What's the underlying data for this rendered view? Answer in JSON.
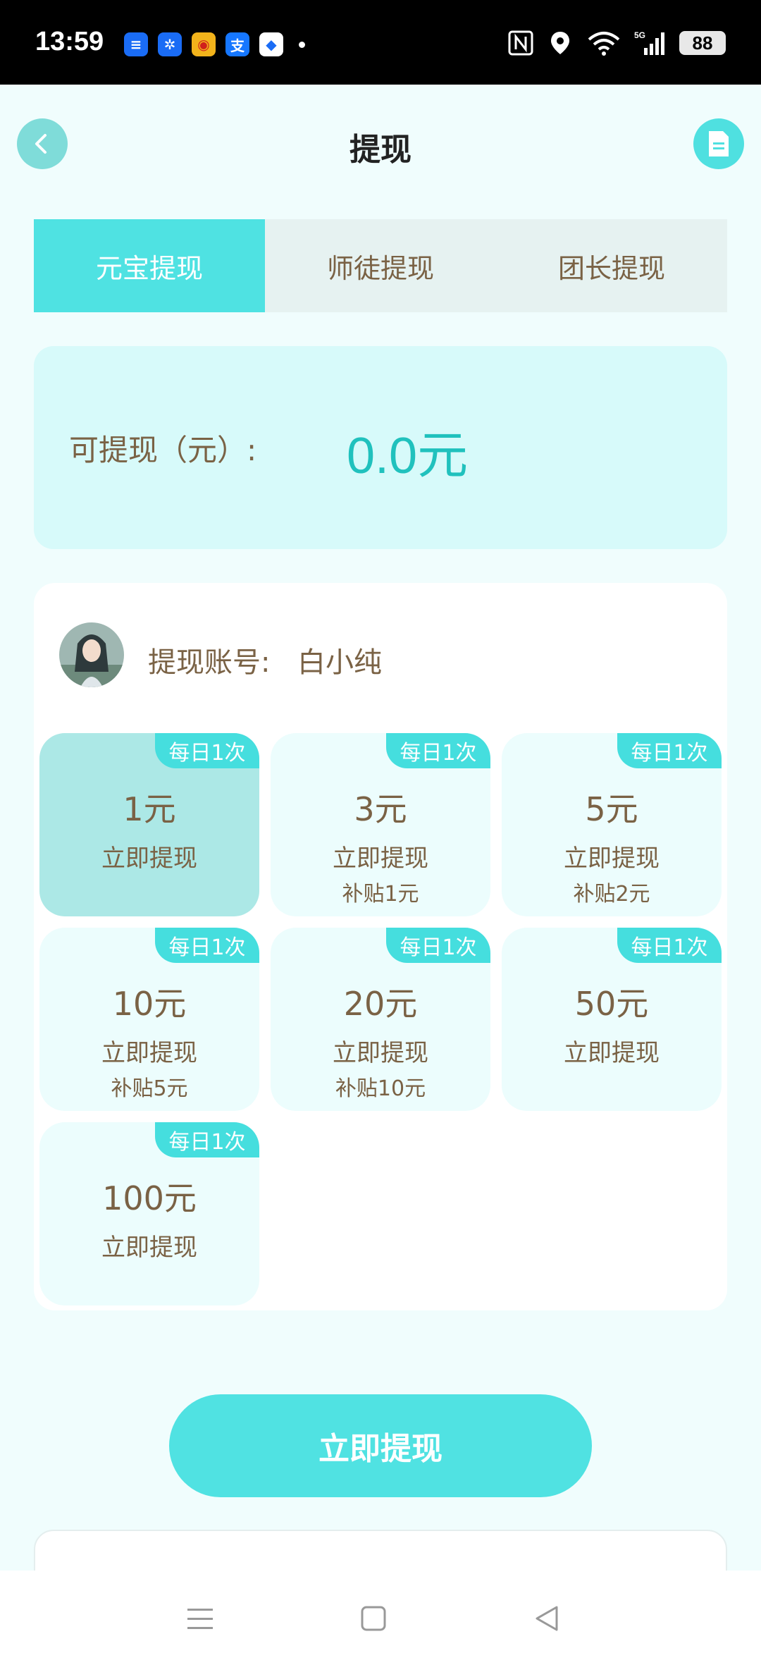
{
  "status_bar": {
    "time": "13:59",
    "apps": [
      {
        "icon": "message-app-icon",
        "color": "#1a6cf5",
        "glyph": "≡"
      },
      {
        "icon": "pinwheel-app-icon",
        "color": "#1a6cf5",
        "glyph": "✲"
      },
      {
        "icon": "weibo-app-icon",
        "color": "#f2b31b",
        "glyph": "◉"
      },
      {
        "icon": "alipay-app-icon",
        "color": "#1677ff",
        "glyph": "支"
      },
      {
        "icon": "browser-app-icon",
        "color": "#ffffff",
        "glyph": "◆"
      }
    ],
    "battery": "88"
  },
  "header": {
    "title": "提现",
    "back_icon": "chevron-left-icon",
    "record_icon": "document-icon"
  },
  "tabs": [
    {
      "label": "元宝提现",
      "active": true
    },
    {
      "label": "师徒提现",
      "active": false
    },
    {
      "label": "团长提现",
      "active": false
    }
  ],
  "balance": {
    "label": "可提现（元）:",
    "value": "0.0元"
  },
  "account": {
    "label": "提现账号:",
    "name": "白小纯"
  },
  "options": [
    {
      "tag": "每日1次",
      "amount": "1元",
      "action": "立即提现",
      "sub": "",
      "selected": true
    },
    {
      "tag": "每日1次",
      "amount": "3元",
      "action": "立即提现",
      "sub": "补贴1元",
      "selected": false
    },
    {
      "tag": "每日1次",
      "amount": "5元",
      "action": "立即提现",
      "sub": "补贴2元",
      "selected": false
    },
    {
      "tag": "每日1次",
      "amount": "10元",
      "action": "立即提现",
      "sub": "补贴5元",
      "selected": false
    },
    {
      "tag": "每日1次",
      "amount": "20元",
      "action": "立即提现",
      "sub": "补贴10元",
      "selected": false
    },
    {
      "tag": "每日1次",
      "amount": "50元",
      "action": "立即提现",
      "sub": "",
      "selected": false
    },
    {
      "tag": "每日1次",
      "amount": "100元",
      "action": "立即提现",
      "sub": "",
      "selected": false
    }
  ],
  "submit_label": "立即提现",
  "colors": {
    "accent": "#4fe2e2",
    "balance_text": "#20c1bd",
    "body_text": "#7a6245"
  }
}
